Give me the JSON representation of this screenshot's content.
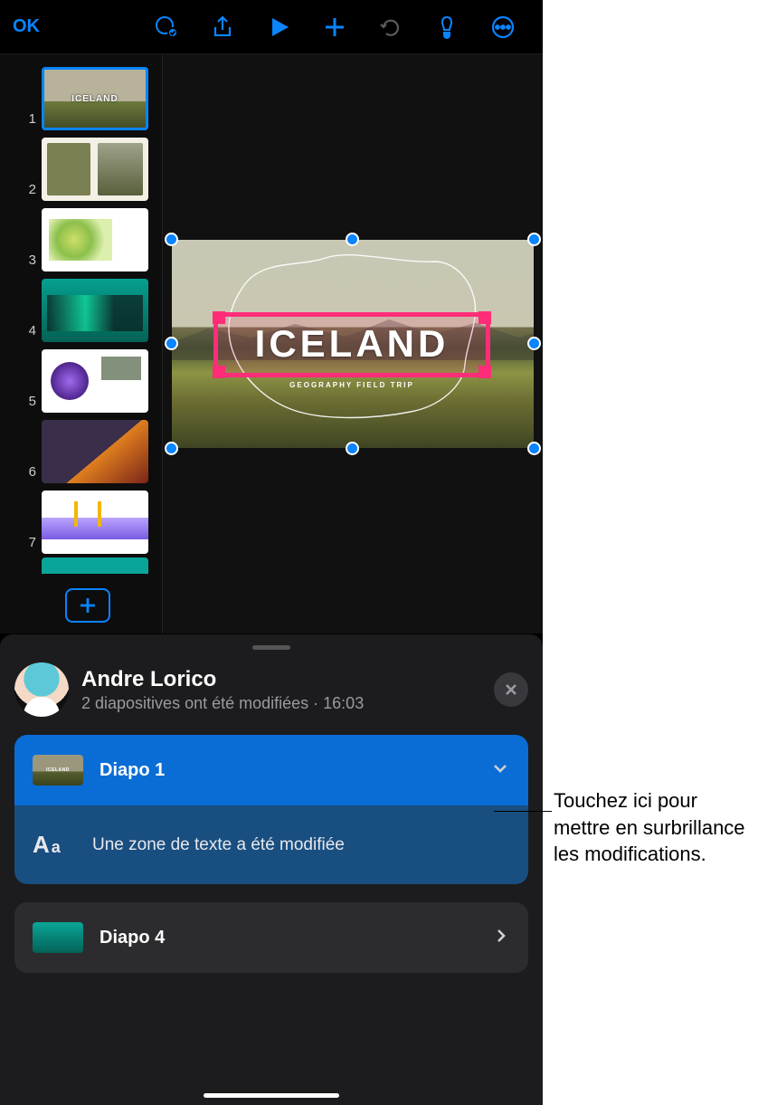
{
  "toolbar": {
    "ok_label": "OK"
  },
  "slides": {
    "numbers": [
      "1",
      "2",
      "3",
      "4",
      "5",
      "6",
      "7"
    ]
  },
  "canvas": {
    "title": "ICELAND",
    "subtitle": "GEOGRAPHY FIELD TRIP"
  },
  "activity": {
    "user_name": "Andre Lorico",
    "summary": "2 diapositives ont été modifiées",
    "separator": " · ",
    "time": "16:03",
    "item1_label": "Diapo 1",
    "item1_detail": "Une zone de texte a été modifiée",
    "item2_label": "Diapo 4"
  },
  "callout": {
    "text": "Touchez ici pour mettre en surbrillance les modifications."
  }
}
